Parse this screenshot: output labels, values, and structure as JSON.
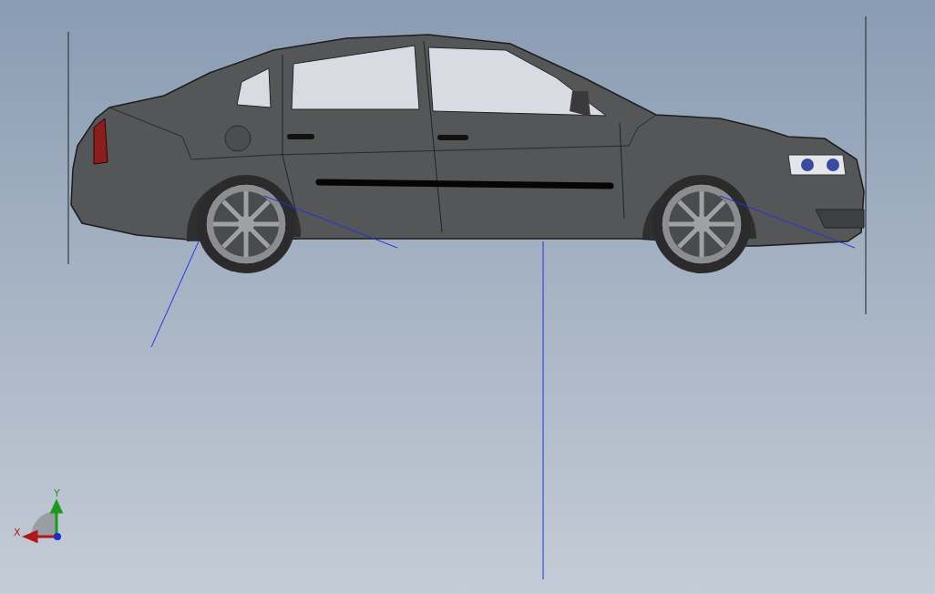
{
  "viewport": {
    "triad": {
      "y_label": "Y",
      "x_label": "X"
    }
  }
}
